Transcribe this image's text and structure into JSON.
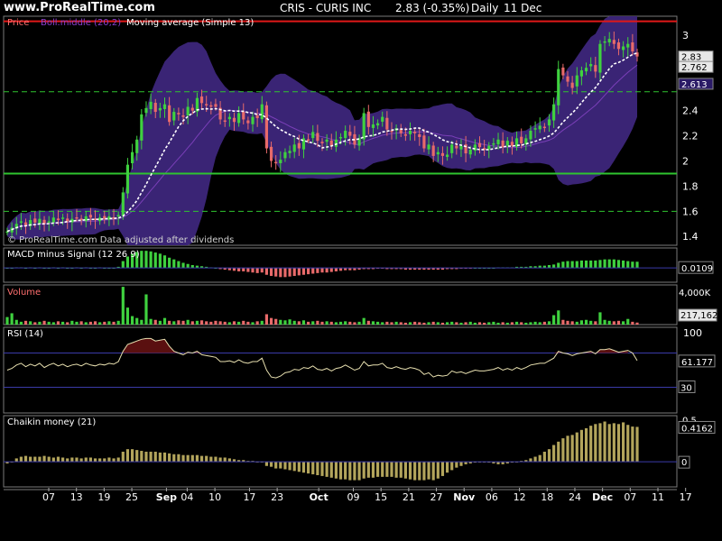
{
  "header": {
    "site": "www.ProRealTime.com",
    "ticker": "CRIS - CURIS INC",
    "last": "2.83 (-0.35%)",
    "period": "Daily",
    "date": "11 Dec"
  },
  "colors": {
    "up": "#3fd13f",
    "down": "#e86a6a",
    "band": "#3a2475",
    "ma": "#ffffff",
    "hline": "#2fc42f",
    "border": "#7a7a7a",
    "zero": "#3a3aa8",
    "chaikin": "#b3a55c"
  },
  "chart_data": [
    {
      "type": "candlestick",
      "title": "Price",
      "legend": [
        "Price",
        "Boll.middle (20,2)",
        "Moving average (Simple 13)"
      ],
      "footer": "© ProRealTime.com  Data adjusted after dividends",
      "yticks": [
        "3",
        "2.8",
        "2.6",
        "2.4",
        "2.2",
        "2",
        "1.8",
        "1.6",
        "1.4"
      ],
      "ylim": [
        1.33,
        3.15
      ],
      "value_labels": {
        "last": "2.83",
        "ma": "2.762",
        "ref": "2.613"
      },
      "resistance": 3.11,
      "support": 1.9,
      "dashed_levels": [
        1.6,
        2.55
      ],
      "close": [
        1.44,
        1.47,
        1.5,
        1.52,
        1.49,
        1.53,
        1.51,
        1.54,
        1.5,
        1.52,
        1.55,
        1.53,
        1.55,
        1.52,
        1.54,
        1.55,
        1.53,
        1.56,
        1.55,
        1.53,
        1.55,
        1.54,
        1.56,
        1.55,
        1.57,
        1.75,
        1.97,
        2.07,
        2.17,
        2.37,
        2.42,
        2.47,
        2.39,
        2.42,
        2.45,
        2.31,
        2.39,
        2.37,
        2.35,
        2.43,
        2.4,
        2.5,
        2.46,
        2.45,
        2.44,
        2.43,
        2.33,
        2.32,
        2.35,
        2.31,
        2.38,
        2.33,
        2.3,
        2.35,
        2.34,
        2.45,
        2.1,
        2.0,
        1.99,
        2.01,
        2.07,
        2.08,
        2.13,
        2.1,
        2.18,
        2.17,
        2.23,
        2.16,
        2.14,
        2.17,
        2.12,
        2.17,
        2.19,
        2.24,
        2.2,
        2.13,
        2.18,
        2.38,
        2.27,
        2.29,
        2.3,
        2.35,
        2.25,
        2.23,
        2.26,
        2.22,
        2.2,
        2.24,
        2.22,
        2.19,
        2.1,
        2.13,
        2.04,
        2.07,
        2.04,
        2.05,
        2.13,
        2.1,
        2.12,
        2.06,
        2.09,
        2.13,
        2.11,
        2.1,
        2.12,
        2.14,
        2.17,
        2.11,
        2.16,
        2.12,
        2.18,
        2.14,
        2.18,
        2.24,
        2.26,
        2.28,
        2.27,
        2.33,
        2.45,
        2.73,
        2.68,
        2.63,
        2.58,
        2.68,
        2.72,
        2.74,
        2.77,
        2.71,
        2.93,
        2.95,
        2.97,
        2.93,
        2.89,
        2.91,
        2.93,
        2.87,
        2.83
      ]
    },
    {
      "type": "bar",
      "title": "MACD minus Signal (12 26 9)",
      "value_label": "0.0109",
      "ylim": [
        -0.025,
        0.035
      ],
      "values": [
        0.0,
        0.0,
        0.001,
        0.001,
        0.0,
        0.001,
        0.0,
        0.001,
        0.0,
        0.0,
        0.001,
        0.0,
        0.001,
        0.0,
        0.0,
        0.001,
        0.0,
        0.001,
        0.0,
        0.0,
        0.001,
        0.0,
        0.0,
        0.0,
        0.002,
        0.012,
        0.02,
        0.025,
        0.028,
        0.03,
        0.03,
        0.029,
        0.027,
        0.025,
        0.022,
        0.018,
        0.015,
        0.012,
        0.009,
        0.007,
        0.005,
        0.004,
        0.003,
        0.002,
        0.001,
        0.0,
        -0.002,
        -0.003,
        -0.004,
        -0.005,
        -0.006,
        -0.006,
        -0.007,
        -0.008,
        -0.009,
        -0.008,
        -0.012,
        -0.014,
        -0.015,
        -0.016,
        -0.016,
        -0.015,
        -0.014,
        -0.013,
        -0.012,
        -0.011,
        -0.01,
        -0.009,
        -0.008,
        -0.008,
        -0.007,
        -0.006,
        -0.005,
        -0.004,
        -0.004,
        -0.004,
        -0.003,
        -0.002,
        -0.002,
        -0.002,
        -0.001,
        -0.001,
        -0.002,
        -0.002,
        -0.002,
        -0.002,
        -0.003,
        -0.003,
        -0.003,
        -0.003,
        -0.003,
        -0.003,
        -0.003,
        -0.003,
        -0.003,
        -0.002,
        -0.002,
        -0.002,
        -0.001,
        -0.001,
        -0.001,
        0.0,
        0.0,
        0.0,
        0.0,
        0.0,
        0.001,
        0.001,
        0.001,
        0.001,
        0.002,
        0.002,
        0.002,
        0.003,
        0.003,
        0.004,
        0.004,
        0.005,
        0.006,
        0.009,
        0.011,
        0.012,
        0.012,
        0.012,
        0.013,
        0.013,
        0.013,
        0.013,
        0.014,
        0.015,
        0.015,
        0.015,
        0.014,
        0.013,
        0.012,
        0.011,
        0.0109
      ],
      "y_zero": 0
    },
    {
      "type": "bar",
      "title": "Volume",
      "value_labels": [
        "4,000K",
        "217,162"
      ],
      "ylim": [
        0,
        4200000
      ],
      "values": [
        800000,
        1200000,
        500000,
        300000,
        400000,
        350000,
        250000,
        300000,
        400000,
        300000,
        250000,
        350000,
        300000,
        250000,
        400000,
        300000,
        350000,
        250000,
        300000,
        350000,
        250000,
        300000,
        350000,
        300000,
        400000,
        4000000,
        1800000,
        900000,
        700000,
        500000,
        3200000,
        600000,
        500000,
        400000,
        700000,
        400000,
        350000,
        450000,
        400000,
        500000,
        350000,
        400000,
        450000,
        350000,
        300000,
        400000,
        350000,
        300000,
        250000,
        350000,
        300000,
        400000,
        300000,
        250000,
        350000,
        400000,
        1100000,
        700000,
        600000,
        500000,
        450000,
        550000,
        400000,
        350000,
        450000,
        300000,
        350000,
        400000,
        300000,
        350000,
        300000,
        250000,
        300000,
        350000,
        300000,
        250000,
        300000,
        700000,
        400000,
        350000,
        300000,
        250000,
        300000,
        250000,
        300000,
        250000,
        200000,
        250000,
        300000,
        250000,
        200000,
        250000,
        300000,
        250000,
        200000,
        250000,
        300000,
        250000,
        200000,
        250000,
        300000,
        200000,
        250000,
        200000,
        250000,
        300000,
        200000,
        250000,
        200000,
        250000,
        300000,
        250000,
        200000,
        250000,
        300000,
        250000,
        300000,
        350000,
        1000000,
        1500000,
        500000,
        400000,
        350000,
        300000,
        450000,
        500000,
        400000,
        350000,
        1300000,
        500000,
        400000,
        350000,
        400000,
        350000,
        600000,
        300000,
        217162
      ]
    },
    {
      "type": "line",
      "title": "RSI (14)",
      "yticks": [
        "100",
        "61.177",
        "30"
      ],
      "levels": [
        70,
        30
      ],
      "ylim": [
        0,
        100
      ],
      "values": [
        50,
        52,
        56,
        58,
        54,
        57,
        55,
        58,
        53,
        56,
        58,
        55,
        57,
        54,
        56,
        57,
        55,
        58,
        56,
        55,
        57,
        56,
        58,
        57,
        60,
        72,
        80,
        82,
        84,
        86,
        87,
        87,
        84,
        85,
        86,
        78,
        72,
        70,
        68,
        71,
        70,
        72,
        68,
        67,
        66,
        65,
        60,
        60,
        61,
        59,
        62,
        59,
        58,
        60,
        60,
        64,
        50,
        42,
        41,
        43,
        47,
        48,
        51,
        50,
        53,
        52,
        55,
        51,
        50,
        52,
        49,
        52,
        53,
        56,
        53,
        50,
        52,
        60,
        55,
        56,
        56,
        58,
        53,
        52,
        54,
        52,
        51,
        53,
        52,
        50,
        45,
        47,
        42,
        44,
        43,
        44,
        49,
        47,
        48,
        46,
        48,
        50,
        49,
        49,
        50,
        51,
        53,
        50,
        52,
        50,
        53,
        51,
        53,
        56,
        57,
        58,
        58,
        61,
        64,
        72,
        70,
        69,
        67,
        69,
        70,
        71,
        72,
        69,
        74,
        74,
        75,
        73,
        71,
        72,
        73,
        70,
        61.177
      ]
    },
    {
      "type": "bar",
      "title": "Chaikin money (21)",
      "yticks": [
        "0.5",
        "0.4162",
        "0"
      ],
      "ylim": [
        -0.3,
        0.55
      ],
      "values": [
        -0.02,
        0.0,
        0.04,
        0.06,
        0.07,
        0.06,
        0.06,
        0.06,
        0.07,
        0.06,
        0.05,
        0.06,
        0.05,
        0.04,
        0.05,
        0.05,
        0.04,
        0.05,
        0.05,
        0.04,
        0.04,
        0.04,
        0.05,
        0.04,
        0.05,
        0.12,
        0.15,
        0.15,
        0.14,
        0.13,
        0.12,
        0.12,
        0.12,
        0.11,
        0.11,
        0.1,
        0.09,
        0.09,
        0.08,
        0.08,
        0.08,
        0.08,
        0.07,
        0.07,
        0.06,
        0.06,
        0.05,
        0.05,
        0.04,
        0.03,
        0.02,
        0.02,
        0.01,
        0.01,
        0.0,
        0.0,
        -0.05,
        -0.06,
        -0.08,
        -0.08,
        -0.09,
        -0.1,
        -0.11,
        -0.12,
        -0.13,
        -0.14,
        -0.15,
        -0.16,
        -0.17,
        -0.18,
        -0.19,
        -0.2,
        -0.21,
        -0.21,
        -0.22,
        -0.22,
        -0.22,
        -0.2,
        -0.19,
        -0.19,
        -0.18,
        -0.18,
        -0.18,
        -0.18,
        -0.19,
        -0.19,
        -0.2,
        -0.21,
        -0.22,
        -0.22,
        -0.22,
        -0.21,
        -0.22,
        -0.2,
        -0.17,
        -0.13,
        -0.1,
        -0.07,
        -0.05,
        -0.03,
        -0.02,
        -0.01,
        0.0,
        0.0,
        -0.01,
        -0.02,
        -0.03,
        -0.03,
        -0.02,
        -0.01,
        0.0,
        0.01,
        0.02,
        0.04,
        0.06,
        0.08,
        0.12,
        0.15,
        0.2,
        0.24,
        0.28,
        0.31,
        0.32,
        0.35,
        0.38,
        0.4,
        0.43,
        0.45,
        0.46,
        0.48,
        0.45,
        0.46,
        0.45,
        0.47,
        0.44,
        0.42,
        0.4162
      ]
    }
  ],
  "xaxis": {
    "labels": [
      {
        "text": "07",
        "i": 3
      },
      {
        "text": "13",
        "i": 7
      },
      {
        "text": "19",
        "i": 11
      },
      {
        "text": "25",
        "i": 15
      },
      {
        "text": "Sep",
        "i": 20,
        "bold": true
      },
      {
        "text": "04",
        "i": 23
      },
      {
        "text": "10",
        "i": 27
      },
      {
        "text": "17",
        "i": 32
      },
      {
        "text": "23",
        "i": 36
      },
      {
        "text": "Oct",
        "i": 42,
        "bold": true
      },
      {
        "text": "09",
        "i": 47
      },
      {
        "text": "15",
        "i": 51
      },
      {
        "text": "21",
        "i": 55
      },
      {
        "text": "27",
        "i": 59
      },
      {
        "text": "Nov",
        "i": 63,
        "bold": true
      },
      {
        "text": "06",
        "i": 67
      },
      {
        "text": "12",
        "i": 71
      },
      {
        "text": "18",
        "i": 75
      },
      {
        "text": "24",
        "i": 79
      },
      {
        "text": "Dec",
        "i": 83,
        "bold": true
      },
      {
        "text": "07",
        "i": 87
      },
      {
        "text": "11",
        "i": 91
      },
      {
        "text": "17",
        "i": 95
      }
    ]
  }
}
